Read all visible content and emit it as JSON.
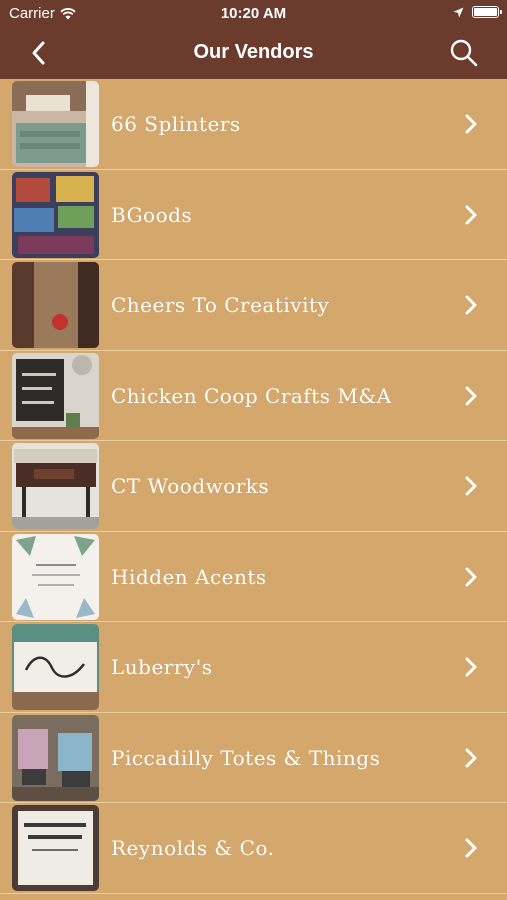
{
  "status_bar": {
    "carrier": "Carrier",
    "time": "10:20 AM"
  },
  "nav": {
    "title": "Our Vendors"
  },
  "vendors": [
    {
      "name": "66 Splinters"
    },
    {
      "name": "BGoods"
    },
    {
      "name": "Cheers To Creativity"
    },
    {
      "name": "Chicken Coop Crafts M&A"
    },
    {
      "name": "CT Woodworks"
    },
    {
      "name": "Hidden Acents"
    },
    {
      "name": "Luberry's"
    },
    {
      "name": "Piccadilly Totes & Things"
    },
    {
      "name": "Reynolds & Co."
    }
  ],
  "colors": {
    "nav_bg": "#6b3c2d",
    "list_bg": "#d4a76d",
    "separator": "#e8cf9f",
    "text": "#ffffff"
  },
  "icons": {
    "back": "chevron-left-icon",
    "search": "search-icon",
    "row_disclosure": "chevron-right-icon",
    "wifi": "wifi-icon",
    "location": "location-arrow-icon",
    "battery": "battery-icon"
  }
}
